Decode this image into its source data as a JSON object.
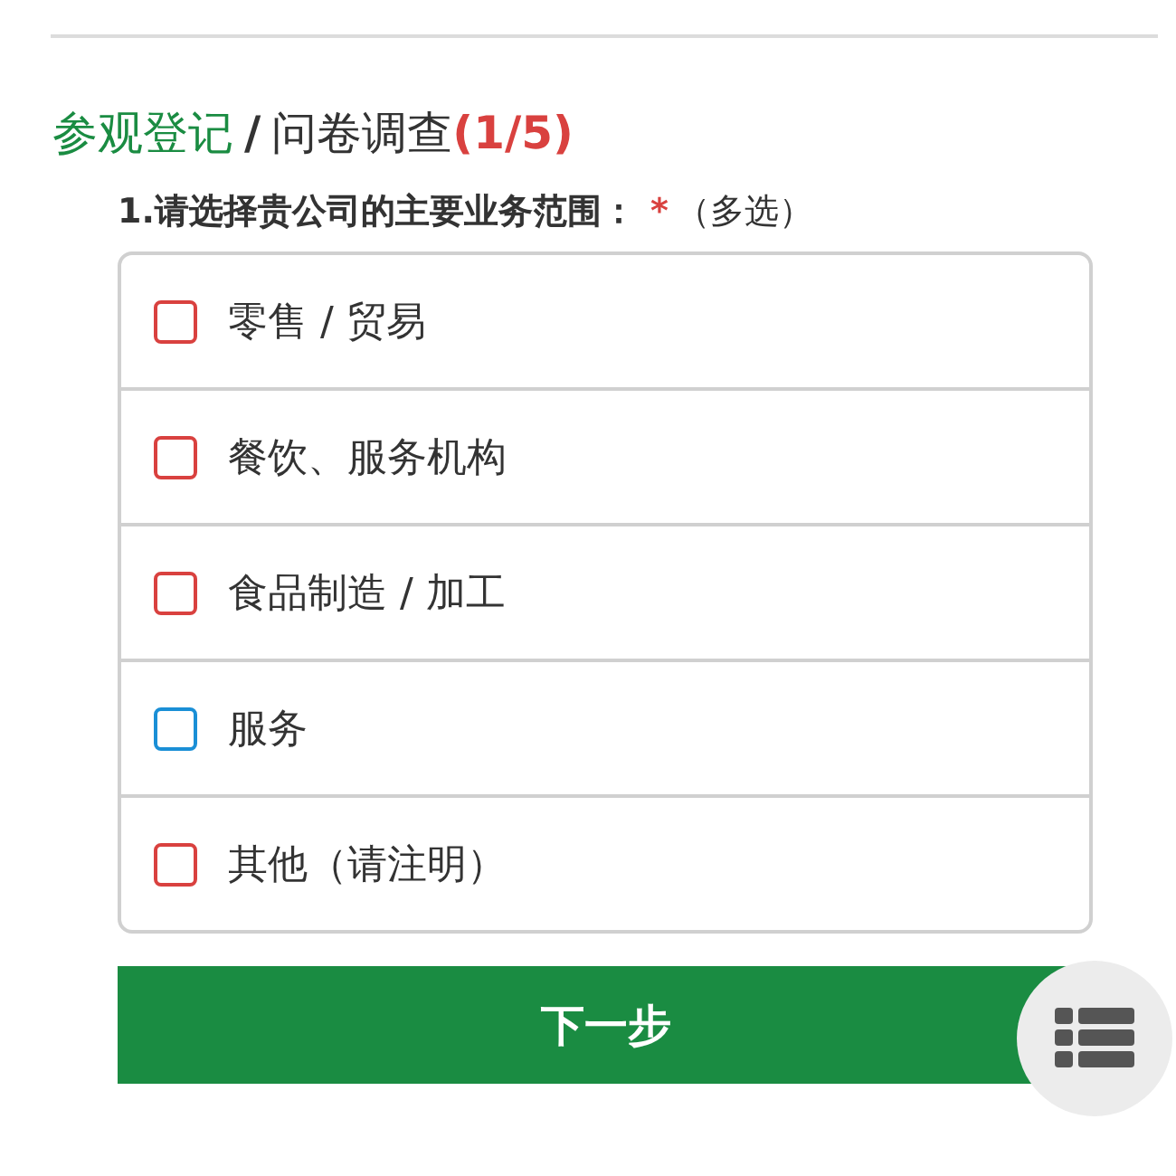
{
  "breadcrumb": {
    "section": "参观登记",
    "separator": "/",
    "page": "问卷调查",
    "progress": "(1/5)"
  },
  "question": {
    "text": "1.请选择贵公司的主要业务范围：",
    "required_mark": "*",
    "hint": "（多选）"
  },
  "options": [
    {
      "label": "零售 / 贸易",
      "checked": false,
      "color": "#d9413f"
    },
    {
      "label": "餐饮、服务机构",
      "checked": false,
      "color": "#d9413f"
    },
    {
      "label": "食品制造 / 加工",
      "checked": false,
      "color": "#d9413f"
    },
    {
      "label": "服务",
      "checked": false,
      "color": "#1a8fd6"
    },
    {
      "label": "其他（请注明）",
      "checked": false,
      "color": "#d9413f"
    }
  ],
  "next_button": "下一步"
}
